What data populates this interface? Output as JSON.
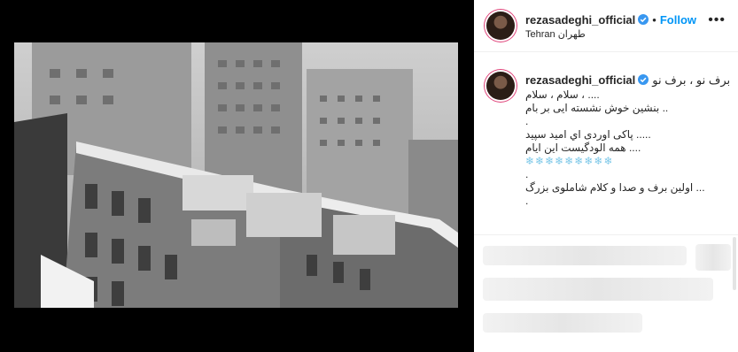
{
  "post": {
    "username": "rezasadeghi_official",
    "follow_label": "Follow",
    "dot": "•",
    "location": "Tehran طهران",
    "more": "•••"
  },
  "caption": {
    "username": "rezasadeghi_official",
    "lines": [
      "برف نو ، برف نو",
      "سلام ، سلام ، ....",
      "بنشین خوش نشسته ایی بر بام ..",
      ".",
      "پاکی اوردی اي امید سپید .....",
      "همه الودگیست این ایام ....",
      "❄❄❄❄❄❄❄❄❄",
      ".",
      "اولین برف و صدا و کلام شاملوی بزرگ ...",
      "."
    ]
  },
  "colors": {
    "follow": "#0095f6",
    "verified": "#3897f0",
    "story_ring": "#e0457b"
  }
}
